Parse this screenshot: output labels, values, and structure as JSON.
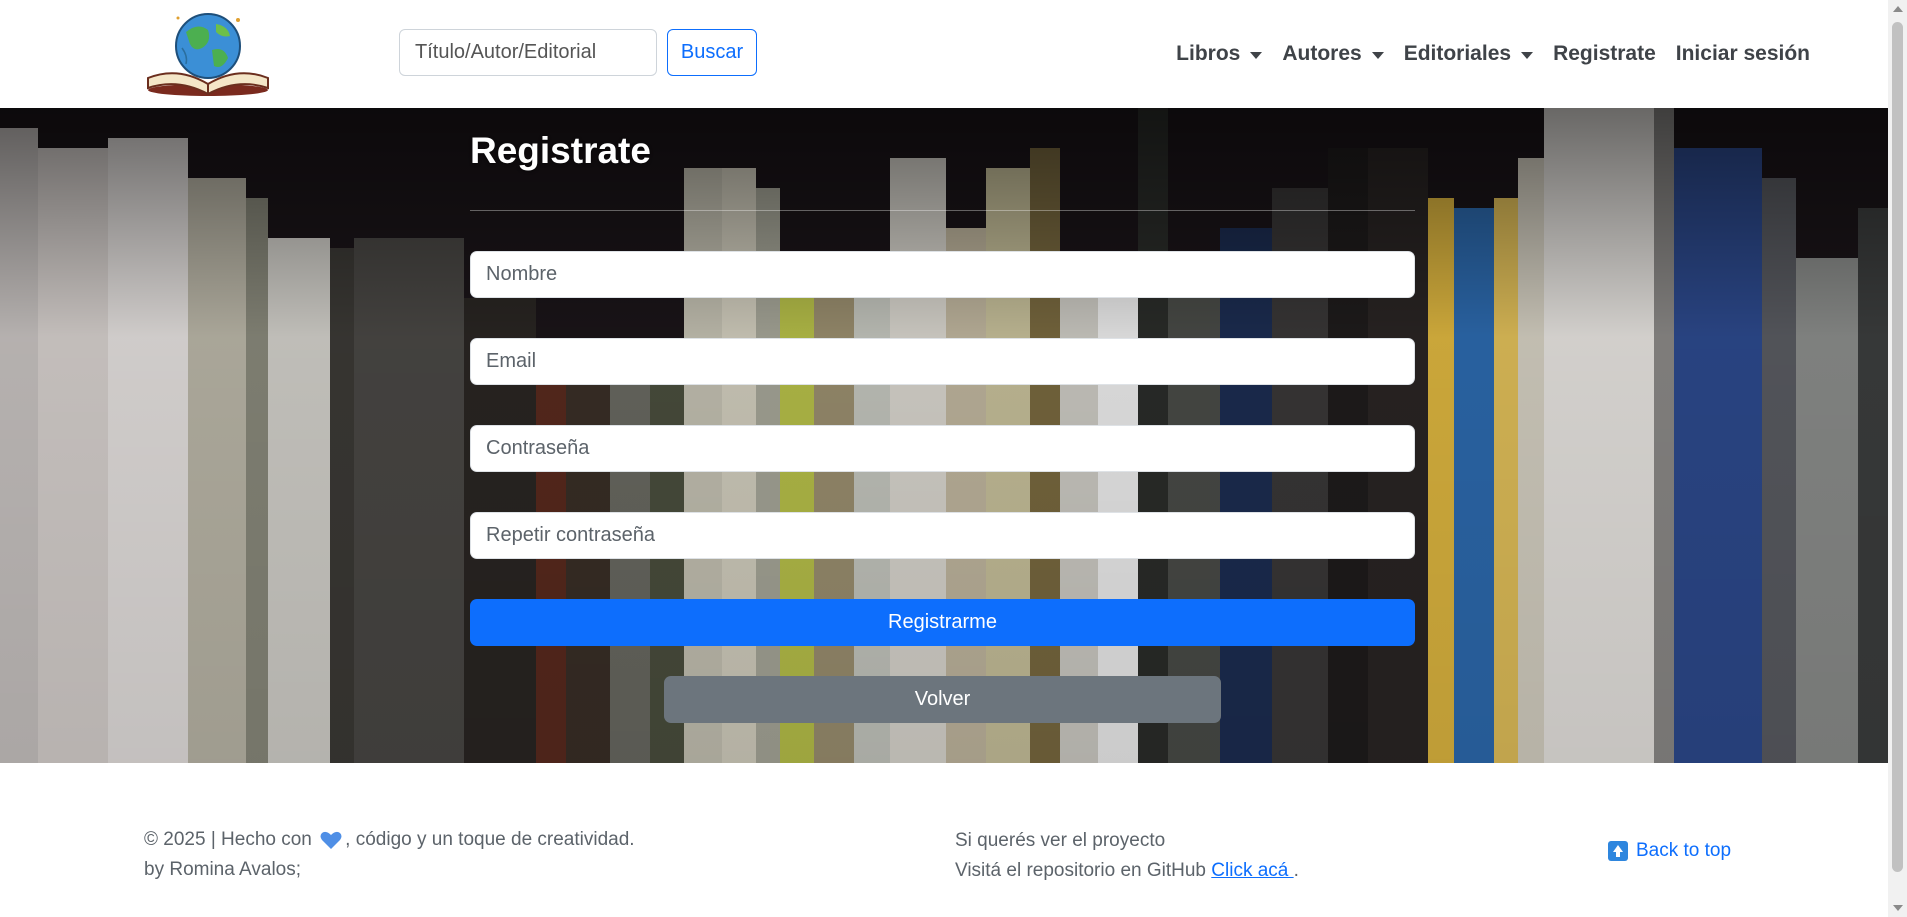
{
  "navbar": {
    "logo_icon": "globe-on-book-logo",
    "search": {
      "placeholder": "Título/Autor/Editorial",
      "value": ""
    },
    "search_button": "Buscar",
    "links": [
      {
        "label": "Libros",
        "dropdown": true
      },
      {
        "label": "Autores",
        "dropdown": true
      },
      {
        "label": "Editoriales",
        "dropdown": true
      },
      {
        "label": "Registrate",
        "dropdown": false
      },
      {
        "label": "Iniciar sesión",
        "dropdown": false
      }
    ]
  },
  "form": {
    "title": "Registrate",
    "fields": {
      "name": "Nombre",
      "email": "Email",
      "password": "Contraseña",
      "password_repeat": "Repetir contraseña"
    },
    "submit_label": "Registrarme",
    "back_label": "Volver"
  },
  "footer": {
    "copyright_before": "© 2025 | Hecho con",
    "copyright_after": ", código y un toque de creatividad.",
    "author": "by Romina Avalos;",
    "project_line": "Si querés ver el proyecto",
    "repo_text": "Visitá el repositorio en GitHub",
    "repo_link": "Click acá ",
    "repo_suffix": ".",
    "back_to_top": "Back to top"
  },
  "colors": {
    "primary": "#0d6efd",
    "secondary": "#6c757d",
    "heart": "#4f8fe6"
  }
}
